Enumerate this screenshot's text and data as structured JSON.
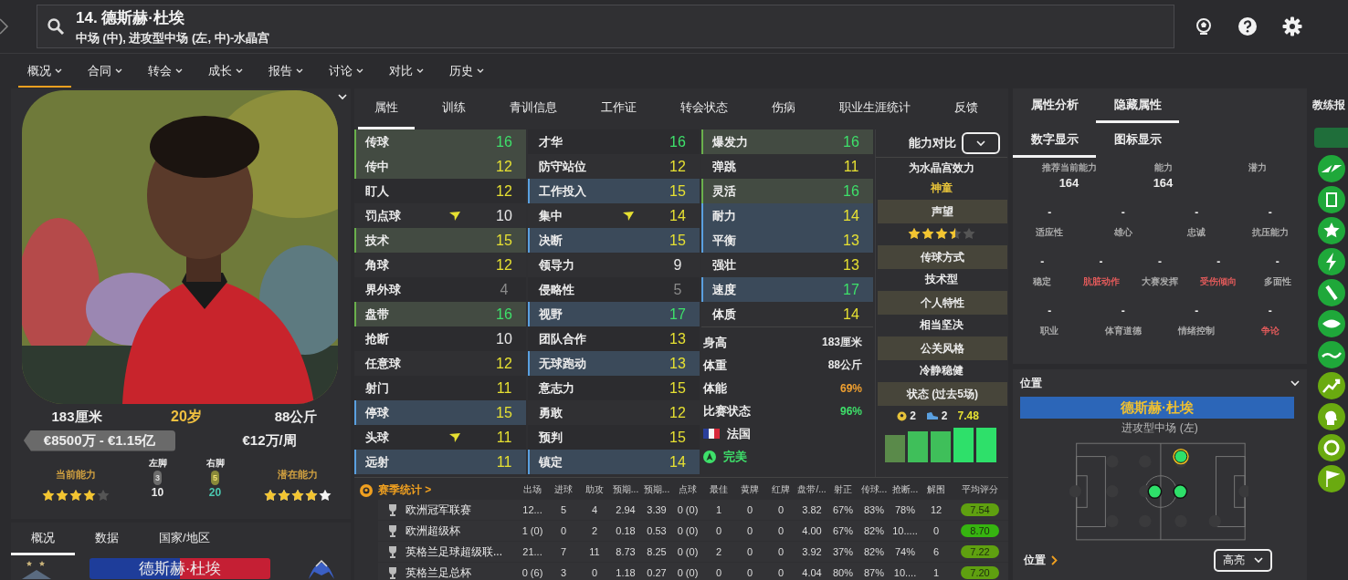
{
  "header": {
    "title": "14. 德斯赫·杜埃",
    "subtitle": "中场 (中), 进攻型中场 (左, 中)-水晶宫"
  },
  "menu": [
    {
      "label": "概况",
      "selected": true
    },
    {
      "label": "合同",
      "selected": false
    },
    {
      "label": "转会",
      "selected": false
    },
    {
      "label": "成长",
      "selected": false
    },
    {
      "label": "报告",
      "selected": false
    },
    {
      "label": "讨论",
      "selected": false
    },
    {
      "label": "对比",
      "selected": false
    },
    {
      "label": "历史",
      "selected": false
    }
  ],
  "profile": {
    "height": "183厘米",
    "age": "20岁",
    "weight": "88公斤",
    "value": "€8500万 - €1.15亿",
    "wage": "€12万/周",
    "current_ability": {
      "label": "当前能力",
      "stars": 4
    },
    "potential_ability": {
      "label": "潜在能力",
      "stars": 4
    },
    "left_foot": {
      "label": "左脚",
      "badge": "3",
      "score": "10",
      "strong": false
    },
    "right_foot": {
      "label": "右脚",
      "badge": "5",
      "score": "20",
      "strong": true
    }
  },
  "lower_tabs": [
    {
      "label": "概况",
      "selected": true
    },
    {
      "label": "数据",
      "selected": false
    },
    {
      "label": "国家/地区",
      "selected": false
    }
  ],
  "name_banner": "德斯赫·杜埃",
  "tabs": [
    {
      "label": "属性",
      "selected": true
    },
    {
      "label": "训练",
      "selected": false
    },
    {
      "label": "青训信息",
      "selected": false
    },
    {
      "label": "工作证",
      "selected": false
    },
    {
      "label": "转会状态",
      "selected": false
    },
    {
      "label": "伤病",
      "selected": false
    },
    {
      "label": "职业生涯统计",
      "selected": false
    },
    {
      "label": "反馈",
      "selected": false
    }
  ],
  "attribute_columns": [
    [
      {
        "name": "传球",
        "value": "16",
        "color": "#3ee06a",
        "key": true,
        "role": false,
        "arrow": false
      },
      {
        "name": "传中",
        "value": "12",
        "color": "#e6e032",
        "key": true,
        "role": false,
        "arrow": false
      },
      {
        "name": "盯人",
        "value": "12",
        "color": "#e6e032",
        "key": false,
        "role": false,
        "arrow": false
      },
      {
        "name": "罚点球",
        "value": "10",
        "color": "#e8e8e8",
        "key": false,
        "role": false,
        "arrow": true
      },
      {
        "name": "技术",
        "value": "15",
        "color": "#e6e032",
        "key": true,
        "role": false,
        "arrow": false
      },
      {
        "name": "角球",
        "value": "12",
        "color": "#e6e032",
        "key": false,
        "role": false,
        "arrow": false
      },
      {
        "name": "界外球",
        "value": "4",
        "color": "#8a8a8a",
        "key": false,
        "role": false,
        "arrow": false
      },
      {
        "name": "盘带",
        "value": "16",
        "color": "#3ee06a",
        "key": true,
        "role": false,
        "arrow": false
      },
      {
        "name": "抢断",
        "value": "10",
        "color": "#e8e8e8",
        "key": false,
        "role": false,
        "arrow": false
      },
      {
        "name": "任意球",
        "value": "12",
        "color": "#e6e032",
        "key": false,
        "role": false,
        "arrow": false
      },
      {
        "name": "射门",
        "value": "11",
        "color": "#e6e032",
        "key": false,
        "role": false,
        "arrow": false
      },
      {
        "name": "停球",
        "value": "15",
        "color": "#e6e032",
        "key": false,
        "role": true,
        "arrow": false
      },
      {
        "name": "头球",
        "value": "11",
        "color": "#e6e032",
        "key": false,
        "role": false,
        "arrow": true
      },
      {
        "name": "远射",
        "value": "11",
        "color": "#e6e032",
        "key": false,
        "role": true,
        "arrow": false
      }
    ],
    [
      {
        "name": "才华",
        "value": "16",
        "color": "#3ee06a",
        "key": false,
        "role": false,
        "arrow": false
      },
      {
        "name": "防守站位",
        "value": "12",
        "color": "#e6e032",
        "key": false,
        "role": false,
        "arrow": false
      },
      {
        "name": "工作投入",
        "value": "15",
        "color": "#e6e032",
        "key": false,
        "role": true,
        "arrow": false
      },
      {
        "name": "集中",
        "value": "14",
        "color": "#e6e032",
        "key": false,
        "role": false,
        "arrow": true
      },
      {
        "name": "决断",
        "value": "15",
        "color": "#e6e032",
        "key": false,
        "role": true,
        "arrow": false
      },
      {
        "name": "领导力",
        "value": "9",
        "color": "#e8e8e8",
        "key": false,
        "role": false,
        "arrow": false
      },
      {
        "name": "侵略性",
        "value": "5",
        "color": "#8a8a8a",
        "key": false,
        "role": false,
        "arrow": false
      },
      {
        "name": "视野",
        "value": "17",
        "color": "#3ee06a",
        "key": false,
        "role": true,
        "arrow": false
      },
      {
        "name": "团队合作",
        "value": "13",
        "color": "#e6e032",
        "key": false,
        "role": false,
        "arrow": false
      },
      {
        "name": "无球跑动",
        "value": "13",
        "color": "#e6e032",
        "key": false,
        "role": true,
        "arrow": false
      },
      {
        "name": "意志力",
        "value": "15",
        "color": "#e6e032",
        "key": false,
        "role": false,
        "arrow": false
      },
      {
        "name": "勇敢",
        "value": "12",
        "color": "#e6e032",
        "key": false,
        "role": false,
        "arrow": false
      },
      {
        "name": "预判",
        "value": "15",
        "color": "#e6e032",
        "key": false,
        "role": false,
        "arrow": false
      },
      {
        "name": "镇定",
        "value": "14",
        "color": "#e6e032",
        "key": false,
        "role": true,
        "arrow": false
      }
    ],
    [
      {
        "name": "爆发力",
        "value": "16",
        "color": "#3ee06a",
        "key": true,
        "role": false,
        "arrow": false
      },
      {
        "name": "弹跳",
        "value": "11",
        "color": "#e6e032",
        "key": false,
        "role": false,
        "arrow": false
      },
      {
        "name": "灵活",
        "value": "16",
        "color": "#3ee06a",
        "key": true,
        "role": false,
        "arrow": false
      },
      {
        "name": "耐力",
        "value": "14",
        "color": "#e6e032",
        "key": false,
        "role": true,
        "arrow": false
      },
      {
        "name": "平衡",
        "value": "13",
        "color": "#e6e032",
        "key": false,
        "role": true,
        "arrow": false
      },
      {
        "name": "强壮",
        "value": "13",
        "color": "#e6e032",
        "key": false,
        "role": false,
        "arrow": false
      },
      {
        "name": "速度",
        "value": "17",
        "color": "#3ee06a",
        "key": false,
        "role": true,
        "arrow": false
      },
      {
        "name": "体质",
        "value": "14",
        "color": "#e6e032",
        "key": false,
        "role": false,
        "arrow": false
      }
    ]
  ],
  "physical": [
    {
      "label": "身高",
      "value": "183厘米",
      "color": "#e8e8e8"
    },
    {
      "label": "体重",
      "value": "88公斤",
      "color": "#e8e8e8"
    },
    {
      "label": "体能",
      "value": "69%",
      "color": "#f0a030"
    },
    {
      "label": "比赛状态",
      "value": "96%",
      "color": "#3ee06a"
    }
  ],
  "nation": "法国",
  "fitness_status": "完美",
  "summary": {
    "compare_label": "能力对比",
    "plays_for": "为水晶宫效力",
    "tag": "神童",
    "reputation": {
      "label": "声望",
      "stars": 3.5
    },
    "sections": [
      {
        "label": "传球方式",
        "value": "技术型"
      },
      {
        "label": "个人特性",
        "value": "相当坚决"
      },
      {
        "label": "公关风格",
        "value": "冷静稳健"
      }
    ],
    "form_label": "状态 (过去5场)",
    "goals": "2",
    "assists": "2",
    "avg_rating": "7.48"
  },
  "season_stats": {
    "title": "赛季统计 >",
    "columns": [
      "出场",
      "进球",
      "助攻",
      "预期...",
      "预期...",
      "点球",
      "最佳",
      "黄牌",
      "红牌",
      "盘带/...",
      "射正",
      "传球...",
      "抢断...",
      "解围",
      "平均评分"
    ],
    "rows": [
      {
        "competition": "欧洲冠军联赛",
        "cells": [
          "12...",
          "5",
          "4",
          "2.94",
          "3.39",
          "0 (0)",
          "1",
          "0",
          "0",
          "3.82",
          "67%",
          "83%",
          "78%",
          "12"
        ],
        "rating": "7.54",
        "color": "#5fa010"
      },
      {
        "competition": "欧洲超级杯",
        "cells": [
          "1 (0)",
          "0",
          "2",
          "0.18",
          "0.53",
          "0 (0)",
          "0",
          "0",
          "0",
          "4.00",
          "67%",
          "82%",
          "10.....",
          "0"
        ],
        "rating": "8.70",
        "color": "#36b410"
      },
      {
        "competition": "英格兰足球超级联...",
        "cells": [
          "21...",
          "7",
          "11",
          "8.73",
          "8.25",
          "0 (0)",
          "2",
          "0",
          "0",
          "3.92",
          "37%",
          "82%",
          "74%",
          "6"
        ],
        "rating": "7.22",
        "color": "#5fa010"
      },
      {
        "competition": "英格兰足总杯",
        "cells": [
          "0 (6)",
          "3",
          "0",
          "1.18",
          "0.27",
          "0 (0)",
          "0",
          "0",
          "0",
          "4.04",
          "80%",
          "87%",
          "10....",
          "1"
        ],
        "rating": "7.20",
        "color": "#5fa010"
      }
    ]
  },
  "analysis_tabs": [
    {
      "label": "属性分析",
      "selected": false
    },
    {
      "label": "隐藏属性",
      "selected": true
    }
  ],
  "view_tabs": [
    {
      "label": "数字显示",
      "selected": true
    },
    {
      "label": "图标显示",
      "selected": false
    }
  ],
  "ability_summary": [
    {
      "label": "推荐当前能力",
      "value": "164"
    },
    {
      "label": "能力",
      "value": "164"
    },
    {
      "label": "潜力"
    }
  ],
  "hidden_rows": [
    [
      {
        "label": "适应性",
        "value": "-",
        "warning": false
      },
      {
        "label": "雄心",
        "value": "-",
        "warning": false
      },
      {
        "label": "忠诚",
        "value": "-",
        "warning": false
      },
      {
        "label": "抗压能力",
        "value": "-",
        "warning": false
      }
    ],
    [
      {
        "label": "稳定",
        "value": "-",
        "warning": false
      },
      {
        "label": "肮脏动作",
        "value": "-",
        "warning": true
      },
      {
        "label": "大赛发挥",
        "value": "-",
        "warning": false
      },
      {
        "label": "受伤倾向",
        "value": "-",
        "warning": true
      },
      {
        "label": "多面性",
        "value": "-",
        "warning": false
      }
    ],
    [
      {
        "label": "职业",
        "value": "-",
        "warning": false
      },
      {
        "label": "体育道德",
        "value": "-",
        "warning": false
      },
      {
        "label": "情绪控制",
        "value": "-",
        "warning": false
      },
      {
        "label": "争论",
        "value": "-",
        "warning": true
      }
    ]
  ],
  "position": {
    "title": "位置",
    "player": "德斯赫·杜埃",
    "role": "进攻型中场 (左)",
    "link": "位置",
    "highlight_button": "高亮"
  },
  "coach_report": {
    "title": "教练报"
  }
}
